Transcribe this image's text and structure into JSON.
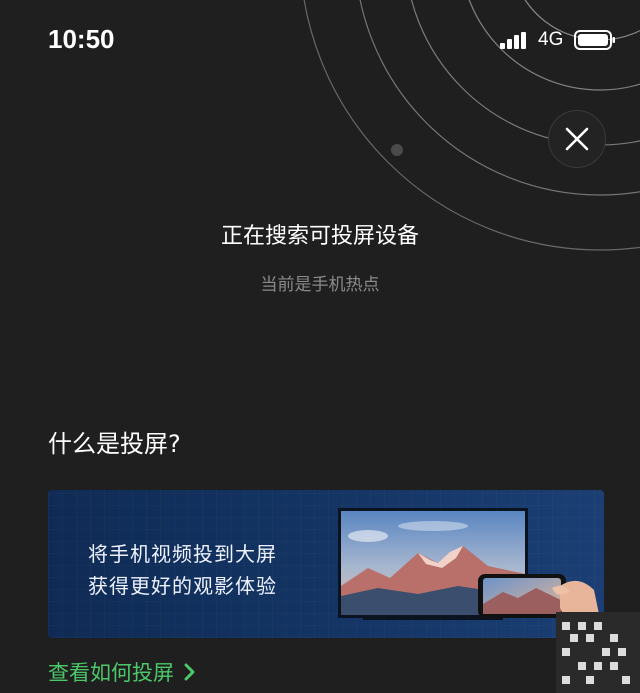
{
  "status_bar": {
    "time": "10:50",
    "network": "4G",
    "icons": [
      "signal-icon",
      "battery-icon"
    ]
  },
  "search_panel": {
    "title": "正在搜索可投屏设备",
    "subtitle": "当前是手机热点",
    "close_icon": "close-icon"
  },
  "info": {
    "heading": "什么是投屏?",
    "banner": {
      "line1": "将手机视频投到大屏",
      "line2": "获得更好的观影体验"
    },
    "link_label": "查看如何投屏",
    "link_icon": "chevron-right-icon"
  },
  "colors": {
    "background": "#1f1f1f",
    "accent_green": "#4cc86a",
    "subtitle_gray": "#8a8a8a",
    "banner_blue": "#143565"
  }
}
